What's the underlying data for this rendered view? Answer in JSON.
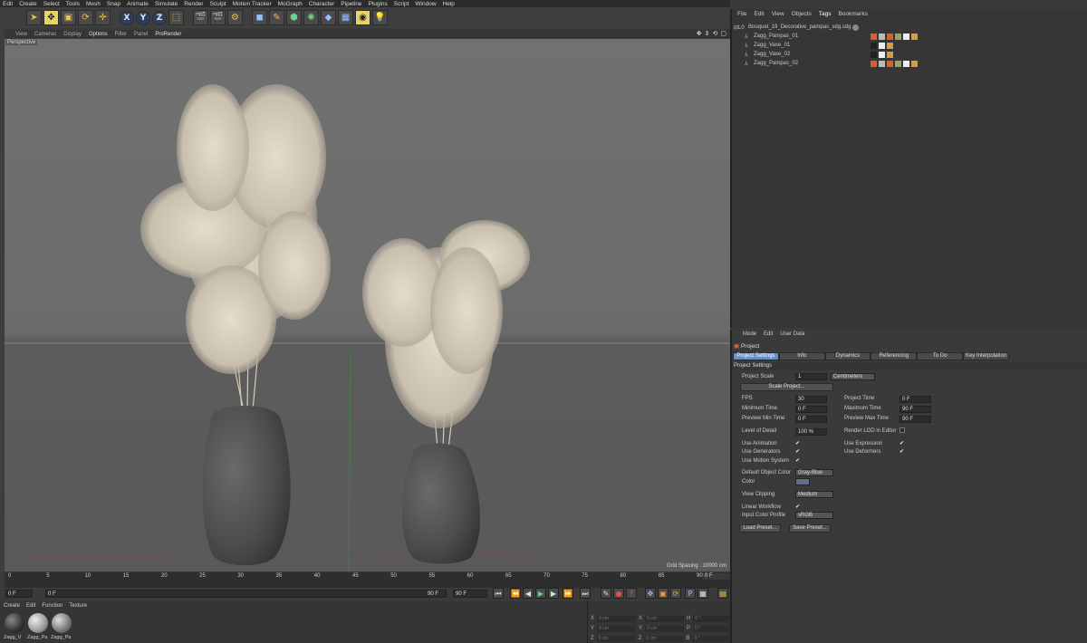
{
  "menubar": [
    "Edit",
    "Create",
    "Select",
    "Tools",
    "Mesh",
    "Snap",
    "Animate",
    "Simulate",
    "Render",
    "Sculpt",
    "Motion Tracker",
    "MoGraph",
    "Character",
    "Pipeline",
    "Plugins",
    "Script",
    "Window",
    "Help"
  ],
  "viewport": {
    "menu": [
      "View",
      "Cameras",
      "Display",
      "Options",
      "Filter",
      "Panel",
      "ProRender"
    ],
    "label": "Perspective",
    "grid_spacing": "Grid Spacing : 10000 cm"
  },
  "axes": [
    "X",
    "Y",
    "Z"
  ],
  "timeline": {
    "ticks": [
      "0",
      "5",
      "10",
      "15",
      "20",
      "25",
      "30",
      "35",
      "40",
      "45",
      "50",
      "55",
      "60",
      "65",
      "70",
      "75",
      "80",
      "85",
      "90"
    ],
    "end_frame": "0 F"
  },
  "transport": {
    "start": "0 F",
    "current": "0 F",
    "end_inner": "90 F",
    "end": "90 F"
  },
  "material_manager": {
    "menu": [
      "Create",
      "Edit",
      "Function",
      "Texture"
    ],
    "materials": [
      "Zagg_V",
      "Zagg_Pa",
      "Zagg_Pa"
    ]
  },
  "coords": {
    "rows": [
      {
        "a": "X",
        "b": "0 cm",
        "c": "X",
        "d": "0 cm",
        "e": "H",
        "f": "0 °"
      },
      {
        "a": "Y",
        "b": "0 cm",
        "c": "Y",
        "d": "0 cm",
        "e": "P",
        "f": "0 °"
      },
      {
        "a": "Z",
        "b": "0 cm",
        "c": "Z",
        "d": "0 cm",
        "e": "B",
        "f": "0 °"
      }
    ]
  },
  "object_manager": {
    "menu": [
      "File",
      "Edit",
      "View",
      "Objects",
      "Tags",
      "Bookmarks"
    ],
    "root": "Bouquet_19_Decorative_pampas_sdg.sdg",
    "objects": [
      "Zagg_Pampas_01",
      "Zagg_Vase_01",
      "Zagg_Vase_02",
      "Zagg_Pampas_02"
    ]
  },
  "attribute_manager": {
    "menu": [
      "Mode",
      "Edit",
      "User Data"
    ],
    "header": "Project",
    "tabs": [
      "Project Settings",
      "Info",
      "Dynamics",
      "Referencing",
      "To Do",
      "Key Interpolation"
    ],
    "section": "Project Settings",
    "project_scale_label": "Project Scale",
    "project_scale_value": "1",
    "project_scale_unit": "Centimeters",
    "scale_project_btn": "Scale Project...",
    "fps_label": "FPS",
    "fps_value": "30",
    "project_time_label": "Project Time",
    "project_time_value": "0 F",
    "min_time_label": "Minimum Time",
    "min_time_value": "0 F",
    "max_time_label": "Maximum Time",
    "max_time_value": "90 F",
    "prev_min_label": "Preview Min Time",
    "prev_min_value": "0 F",
    "prev_max_label": "Preview Max Time",
    "prev_max_value": "90 F",
    "lod_label": "Level of Detail",
    "lod_value": "100 %",
    "render_lod_label": "Render LOD in Editor",
    "use_animation": "Use Animation",
    "use_expression": "Use Expression",
    "use_generators": "Use Generators",
    "use_deformers": "Use Deformers",
    "use_motion": "Use Motion System",
    "default_color_label": "Default Object Color",
    "default_color_value": "Gray-Blue",
    "color_label": "Color",
    "view_clipping_label": "View Clipping",
    "view_clipping_value": "Medium",
    "linear_workflow_label": "Linear Workflow",
    "input_color_label": "Input Color Profile",
    "input_color_value": "sRGB",
    "load_preset": "Load Preset...",
    "save_preset": "Save Preset..."
  },
  "colors": {
    "accent": "#6b8fc0",
    "highlight": "#e8d36a",
    "background": "#3a3a3a"
  }
}
